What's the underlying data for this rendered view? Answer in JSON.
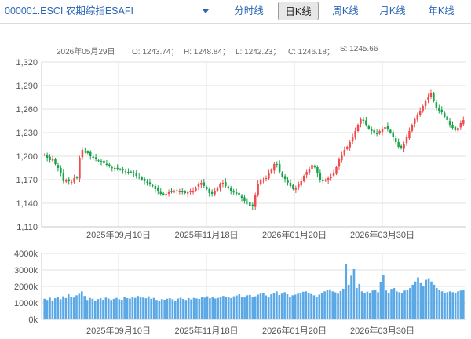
{
  "selector": {
    "label": "000001.ESCI 农期综指ESAFI"
  },
  "tabs": [
    {
      "label": "分时线",
      "active": false
    },
    {
      "label": "日K线",
      "active": true
    },
    {
      "label": "周K线",
      "active": false
    },
    {
      "label": "月K线",
      "active": false
    },
    {
      "label": "年K线",
      "active": false
    }
  ],
  "info": {
    "date": "2026年05月29日",
    "open": "O: 1243.74；",
    "high": "H: 1248.84；",
    "low": "L: 1242.23；",
    "close": "C: 1246.18；",
    "settle": "S: 1245.66"
  },
  "colors": {
    "up": "#ef4d4d",
    "down": "#1aa34a",
    "volume": "#5aa9e6",
    "accent": "#2a66b6"
  },
  "chart_data": {
    "type": "candlestick",
    "price_axis": {
      "min": 1110,
      "max": 1320,
      "ticks": [
        "1,320",
        "1,290",
        "1,260",
        "1,230",
        "1,200",
        "1,170",
        "1,140",
        "1,110"
      ]
    },
    "volume_axis": {
      "min": 0,
      "max": 4000000,
      "ticks": [
        "4000k",
        "3000k",
        "2000k",
        "1000k",
        "0k"
      ]
    },
    "date_labels": [
      "2025年09月10日",
      "2025年11月18日",
      "2026年01月20日",
      "2026年03月30日"
    ],
    "grid": true,
    "close_series": [
      1202,
      1198,
      1195,
      1196,
      1190,
      1185,
      1178,
      1168,
      1170,
      1168,
      1167,
      1172,
      1172,
      1198,
      1208,
      1206,
      1204,
      1200,
      1198,
      1196,
      1194,
      1193,
      1191,
      1189,
      1187,
      1185,
      1184,
      1184,
      1183,
      1182,
      1180,
      1179,
      1180,
      1178,
      1175,
      1173,
      1170,
      1168,
      1166,
      1164,
      1162,
      1158,
      1155,
      1152,
      1151,
      1152,
      1154,
      1155,
      1156,
      1156,
      1155,
      1154,
      1153,
      1154,
      1155,
      1156,
      1160,
      1164,
      1166,
      1162,
      1158,
      1153,
      1152,
      1155,
      1160,
      1164,
      1166,
      1162,
      1159,
      1156,
      1154,
      1152,
      1150,
      1147,
      1143,
      1141,
      1137,
      1136,
      1150,
      1165,
      1170,
      1170,
      1172,
      1178,
      1183,
      1190,
      1189,
      1180,
      1174,
      1171,
      1166,
      1162,
      1158,
      1160,
      1164,
      1168,
      1175,
      1180,
      1183,
      1189,
      1186,
      1178,
      1170,
      1168,
      1170,
      1172,
      1174,
      1178,
      1186,
      1196,
      1202,
      1208,
      1212,
      1218,
      1225,
      1232,
      1240,
      1247,
      1245,
      1240,
      1235,
      1232,
      1230,
      1228,
      1232,
      1235,
      1237,
      1234,
      1230,
      1224,
      1218,
      1212,
      1210,
      1216,
      1224,
      1232,
      1240,
      1247,
      1252,
      1258,
      1264,
      1270,
      1276,
      1280,
      1270,
      1262,
      1258,
      1256,
      1250,
      1246,
      1240,
      1236,
      1233,
      1236,
      1242,
      1246
    ],
    "volume_series": [
      1250,
      1180,
      1320,
      1150,
      1280,
      1360,
      1220,
      1400,
      1290,
      1520,
      1380,
      1320,
      1460,
      1550,
      1700,
      1420,
      1180,
      1300,
      1250,
      1150,
      1230,
      1280,
      1190,
      1320,
      1260,
      1180,
      1240,
      1300,
      1220,
      1190,
      1340,
      1280,
      1260,
      1380,
      1300,
      1420,
      1350,
      1320,
      1280,
      1400,
      1250,
      1300,
      1180,
      1120,
      1230,
      1190,
      1250,
      1280,
      1220,
      1150,
      1260,
      1310,
      1240,
      1180,
      1290,
      1210,
      1300,
      1270,
      1240,
      1380,
      1320,
      1400,
      1280,
      1350,
      1260,
      1300,
      1380,
      1420,
      1360,
      1330,
      1290,
      1400,
      1450,
      1520,
      1380,
      1330,
      1460,
      1480,
      1350,
      1400,
      1500,
      1560,
      1620,
      1450,
      1380,
      1520,
      1600,
      1700,
      1480,
      1560,
      1650,
      1520,
      1380,
      1460,
      1500,
      1560,
      1620,
      1680,
      1700,
      1620,
      1540,
      1460,
      1380,
      1500,
      1620,
      1700,
      1760,
      1820,
      1700,
      1640,
      1560,
      1720,
      1860,
      3350,
      2100,
      2650,
      3050,
      1900,
      2150,
      1700,
      1600,
      1680,
      1600,
      1750,
      1800,
      1650,
      2250,
      2700,
      1750,
      1600,
      1850,
      1900,
      1700,
      1650,
      1600,
      1750,
      1800,
      1900,
      2100,
      2300,
      2550,
      2200,
      2000,
      2400,
      2500,
      2300,
      2100,
      1900,
      1800,
      1700,
      1600,
      1650,
      1700,
      1650,
      1600,
      1700,
      1750,
      1800
    ]
  }
}
